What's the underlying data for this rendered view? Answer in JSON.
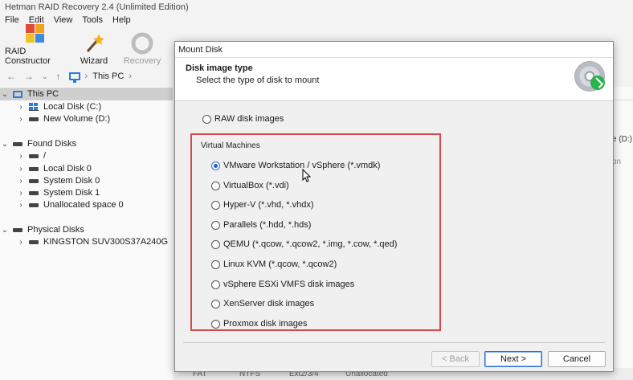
{
  "app": {
    "title": "Hetman RAID Recovery 2.4 (Unlimited Edition)",
    "menu": [
      "File",
      "Edit",
      "View",
      "Tools",
      "Help"
    ],
    "toolbar": {
      "raid_constructor": "RAID Constructor",
      "wizard": "Wizard",
      "recovery": "Recovery"
    },
    "breadcrumb": "This PC"
  },
  "tree": {
    "this_pc": "This PC",
    "local_disk_c": "Local Disk (C:)",
    "new_volume_d": "New Volume (D:)",
    "found_disks": "Found Disks",
    "root": "/",
    "local_disk_0": "Local Disk 0",
    "system_disk_0": "System Disk 0",
    "system_disk_1": "System Disk 1",
    "unallocated_0": "Unallocated space 0",
    "physical_disks": "Physical Disks",
    "kingston": "KINGSTON SUV300S37A240G"
  },
  "right_pane": {
    "label1": "e (D:)",
    "label2": "on"
  },
  "bottom_strip": [
    "FAT",
    "NTFS",
    "Ext2/3/4",
    "Unallocated"
  ],
  "dialog": {
    "title": "Mount Disk",
    "heading": "Disk image type",
    "subheading": "Select the type of disk to mount",
    "raw_option": "RAW disk images",
    "group_label": "Virtual Machines",
    "options": [
      "VMware Workstation / vSphere (*.vmdk)",
      "VirtualBox (*.vdi)",
      "Hyper-V (*.vhd, *.vhdx)",
      "Parallels (*.hdd, *.hds)",
      "QEMU (*.qcow, *.qcow2, *.img, *.cow, *.qed)",
      "Linux KVM (*.qcow, *.qcow2)",
      "vSphere ESXi VMFS disk images",
      "XenServer disk images",
      "Proxmox disk images"
    ],
    "selected_index": 0,
    "buttons": {
      "back": "< Back",
      "next": "Next >",
      "cancel": "Cancel"
    }
  },
  "colors": {
    "highlight": "#d8474f",
    "accent": "#2a6fd6"
  }
}
